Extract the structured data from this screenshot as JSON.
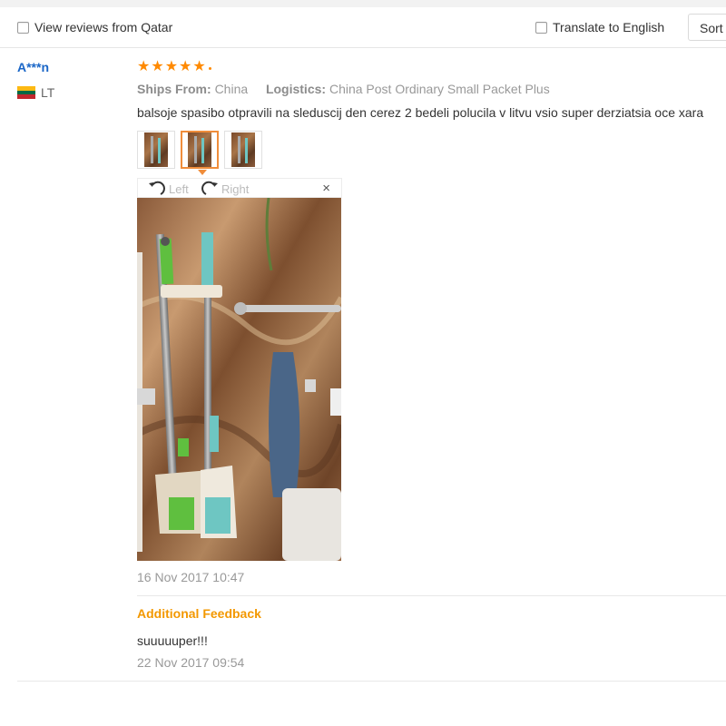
{
  "filters": {
    "view_reviews_label": "View reviews from Qatar",
    "translate_label": "Translate to English",
    "sort_label": "Sort"
  },
  "review": {
    "buyer_name": "A***n",
    "country_code": "LT",
    "flag_colors": [
      "#fdb913",
      "#006a44",
      "#c1272d"
    ],
    "rating": 5,
    "ships_from_label": "Ships From:",
    "ships_from_value": "China",
    "logistics_label": "Logistics:",
    "logistics_value": "China Post Ordinary Small Packet Plus",
    "text": "balsoje spasibo otpravili na sleduscij den cerez 2 bedeli polucila v litvu vsio super derziatsia oce xara",
    "thumbnail_count": 3,
    "active_thumbnail": 2,
    "viewer": {
      "rotate_left_label": "Left",
      "rotate_right_label": "Right",
      "close_glyph": "×"
    },
    "date": "16 Nov 2017 10:47"
  },
  "additional_feedback": {
    "title": "Additional Feedback",
    "text": "suuuuuper!!!",
    "date": "22 Nov 2017 09:54"
  },
  "colors": {
    "accent_orange": "#f39800",
    "star_orange": "#ff8a00",
    "buyer_blue": "#1a66c7"
  },
  "icons": [
    "checkbox-icon",
    "star-icon",
    "rotate-left-icon",
    "rotate-right-icon",
    "close-icon",
    "flag-lt-icon"
  ]
}
